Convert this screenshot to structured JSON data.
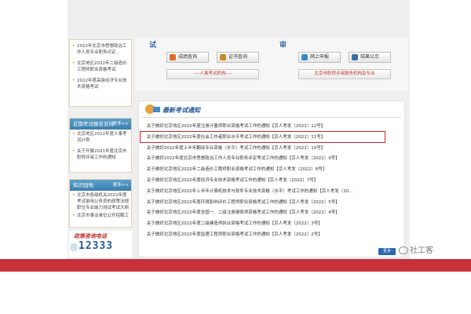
{
  "left_top_items": [
    "2022年北京市思想政治工作人员专业职务评定...",
    "北京地区2022年二级造价工程师职业资格考试",
    "2022年度高级经济专业技术资格考试"
  ],
  "box_recent": {
    "title": "近期考试报名安排",
    "more": "更多>>",
    "items": [
      "北京地区2022年度人事考试计划",
      "关于开展2021年度北京市职称评审工作的通知"
    ]
  },
  "box_knowledge": {
    "title": "知识园地",
    "more": "更多>>",
    "items": [
      "北京市各级机关2022年度考试录用公务员的政策法规职位专业能力测试考试大纲",
      "北京市事业单位公开招聘工"
    ]
  },
  "hotline": {
    "label": "政策咨询电话",
    "number": "12333"
  },
  "top_area": {
    "chars": [
      "试",
      "审"
    ],
    "buttons": [
      {
        "label": "成绩查询",
        "color": "#d86a2a"
      },
      {
        "label": "证书查询",
        "color": "#c88a28"
      },
      {
        "label": "网上申报",
        "color": "#3a8ac8"
      },
      {
        "label": "结果公示",
        "color": "#3a6da8"
      }
    ],
    "wide_buttons": [
      "----人事考试机构----",
      "北京市职称评审服务机构及专业"
    ]
  },
  "news": {
    "title": "最新考试通知",
    "items": [
      "关于做好北京地区2022年度注册计量师职业资格考试工作的通知【京人考发〔2022〕12号】",
      "关于做好北京地区2022年度社会工作者职业水平考试工作的通知【京人考发〔2022〕11号】",
      "关于做好2022年度上半年翻译专业资格（水平）考试工作的通知【京人考发〔2022〕10号】",
      "关于做好2022年度北京市思想政治工作人员专业职务评定考试工作的通知【京人考发〔2022〕9号】",
      "关于做好北京地区2022年二级造价工程师职业资格考试工作的通知【京人考发〔2022〕8号】",
      "关于做好北京地区2022年度经济专业技术资格考试工作的通知【京人考发〔2022〕7号】",
      "关于做好北京地区2022年上半年计算机技术与软件专业技术资格（水平）考试工作的通知【京人考发〔20...",
      "关于做好北京地区2022年度环境影响评价工程师职业资格考试工作的通知【京人考发〔2022〕5号】",
      "关于做好北京地区2022年度全国一、二级注册建筑师资格考试工作的通知【京人考发〔2022〕4号】",
      "关于做好北京地区2022年度二级建造师执业资格考试工作的通知【京人考发〔2022〕3号】",
      "关于做好北京地区2022年度监理工程师职业资格考试工作的通知【京人考发〔2022〕2号】"
    ],
    "more": "更多"
  },
  "watermark": "社工客",
  "colors": {
    "footer_red": "#c8303a",
    "highlight_red": "#d8202a",
    "head_blue": "#3c7fae"
  }
}
